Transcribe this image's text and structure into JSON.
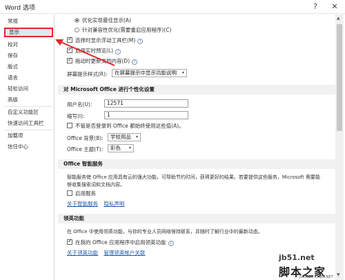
{
  "window": {
    "title": "Word 选项",
    "help": "?",
    "close": "✕"
  },
  "sidebar": {
    "items": [
      {
        "label": "常规"
      },
      {
        "label": "显示"
      },
      {
        "label": "校对"
      },
      {
        "label": "保存"
      },
      {
        "label": "版式"
      },
      {
        "label": "语言"
      },
      {
        "label": "轻松访问"
      },
      {
        "label": "高级"
      },
      {
        "label": "自定义功能区"
      },
      {
        "label": "快速访问工具栏"
      },
      {
        "label": "加载项"
      },
      {
        "label": "信任中心"
      }
    ],
    "active_index": 1
  },
  "ui_options": {
    "radio_optimize_display": "优化实现最佳显示(A)",
    "radio_optimize_compat": "针对兼容性优化(需要重启应用程序)(C)",
    "show_mini_toolbar": "选择时显示浮动工具栏(M)",
    "live_preview": "启用实时预览(L)",
    "update_on_drag": "拖动时更新文档内容(D)",
    "screentip_label": "屏幕提示样式(R):",
    "screentip_value": "在屏幕提示中显示功能说明",
    "info_glyph": "i"
  },
  "personalize": {
    "heading": "对 Microsoft Office 进行个性化设置",
    "username_label": "用户名(U):",
    "username_value": "12571",
    "initials_label": "缩写(I):",
    "initials_value": "1",
    "always_use_label": "不管是否登录到 Office 都始终使用这些值(A)。",
    "background_label": "Office 背景(B):",
    "background_value": "学校用品",
    "theme_label": "Office 主题(T):",
    "theme_value": "彩色"
  },
  "intelligent": {
    "heading": "Office 智能服务",
    "description_line1": "智能服务使 Office 应用具有云的强大功能，可帮助节约时间，获得更好的结果。若要提供这些服务，Microsoft 需要能",
    "description_line2": "够收集搜索词和文档内容。",
    "enable_label": "启用服务",
    "about_link": "关于智能服务",
    "privacy_link": "隐私声明"
  },
  "linkedin": {
    "heading": "领英功能",
    "description": "在 Office 中使用领英功能，与你的专业人员网络保持联系，并随时了解行业中的最新动态。",
    "enable_label": "在我的 Office 应用程序中启用领英功能",
    "about_link": "关于领英功能",
    "manage_link": "管理领英帐户关联"
  },
  "watermark": {
    "url": "jb51.net",
    "brand": "脚本之家",
    "sub": "JIAOBEN ZHIJIA.NET"
  },
  "colors": {
    "highlight_red": "#e0262a",
    "link_blue": "#1f5aa6",
    "section_bg": "#f1f1f1"
  },
  "icons": {
    "dropdown": "chevron-down-icon",
    "scroll_up": "▲",
    "scroll_down": "▼",
    "dropdown_glyph": "▾"
  }
}
